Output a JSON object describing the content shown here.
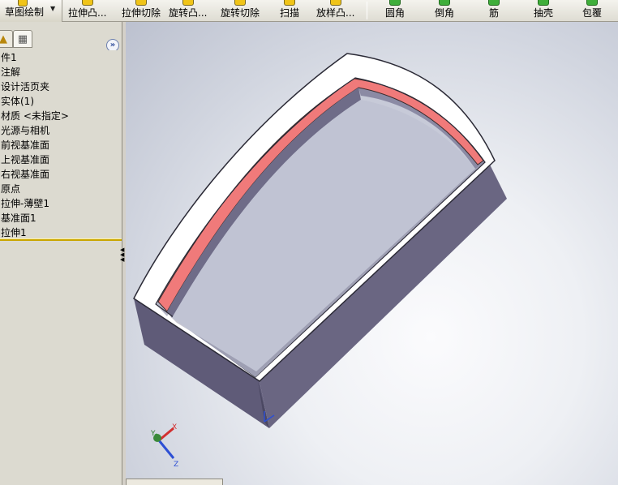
{
  "toolbar": {
    "sketch_label": "草图绘制",
    "buttons": [
      {
        "label": "拉伸凸..."
      },
      {
        "label": "拉伸切除"
      },
      {
        "label": "旋转凸..."
      },
      {
        "label": "旋转切除"
      },
      {
        "label": "扫描"
      },
      {
        "label": "放样凸..."
      },
      {
        "label": "圆角"
      },
      {
        "label": "倒角"
      },
      {
        "label": "筋"
      },
      {
        "label": "抽壳"
      },
      {
        "label": "包覆"
      }
    ]
  },
  "feature_tree": {
    "items": [
      {
        "label": "件1"
      },
      {
        "label": "注解"
      },
      {
        "label": "设计活页夹"
      },
      {
        "label": "实体(1)"
      },
      {
        "label": "材质 <未指定>"
      },
      {
        "label": "光源与相机"
      },
      {
        "label": "前视基准面"
      },
      {
        "label": "上视基准面"
      },
      {
        "label": "右视基准面"
      },
      {
        "label": "原点"
      },
      {
        "label": "拉伸-薄壁1"
      },
      {
        "label": "基准面1"
      },
      {
        "label": "拉伸1"
      }
    ]
  },
  "triad": {
    "x_label": "X",
    "y_label": "Y",
    "z_label": "Z"
  },
  "colors": {
    "model_side": "#6a6682",
    "model_top": "#ffffff",
    "highlight_face": "#f07a7a",
    "rollback_bar": "#c9a500",
    "viewport_bg": "#eef0f4"
  }
}
